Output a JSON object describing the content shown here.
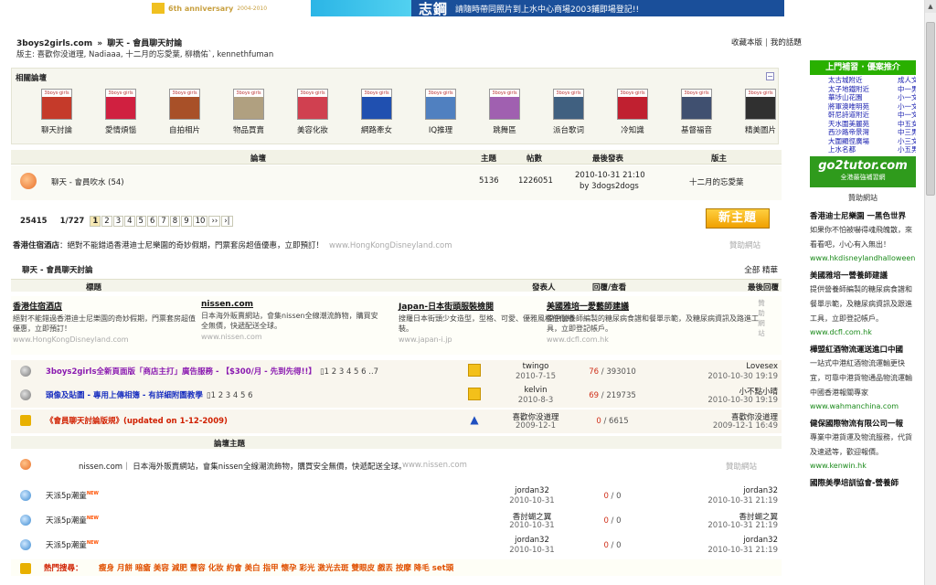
{
  "banners": {
    "left_text": "6th anniversary",
    "left_years": "2004-2010",
    "right_big": "志鋼",
    "right_text": "請隨時帶同照片到上水中心商場2003鋪即場登記!!"
  },
  "header": {
    "site": "3boys2girls.com",
    "sep": "»",
    "section": "聊天 - 會員聊天討論",
    "moderators": "版主: 喜歡你没道理, Nadiaaa, 十二月的忘愛葉, 柳橋佑`, kennethfuman",
    "user_links": [
      "收藏本版",
      "我的話題"
    ]
  },
  "related": {
    "title": "相關論壇",
    "collapse": "−",
    "tag": "3boys·girls",
    "items": [
      {
        "label": "聊天討論",
        "color": "#c53a2a"
      },
      {
        "label": "愛情煩惱",
        "color": "#d02040"
      },
      {
        "label": "自拍相片",
        "color": "#a85028"
      },
      {
        "label": "物品買賣",
        "color": "#b0a080"
      },
      {
        "label": "美容化妝",
        "color": "#d04050"
      },
      {
        "label": "網路牽女",
        "color": "#2050b0"
      },
      {
        "label": "IQ推理",
        "color": "#5080c0"
      },
      {
        "label": "跳舞區",
        "color": "#a060b0"
      },
      {
        "label": "派台歌词",
        "color": "#406080"
      },
      {
        "label": "冷知識",
        "color": "#c02030"
      },
      {
        "label": "基督福音",
        "color": "#405070"
      },
      {
        "label": "精美圖片",
        "color": "#303030"
      }
    ]
  },
  "forum_table": {
    "headers": {
      "forum": "論壇",
      "topics": "主題",
      "posts": "帖數",
      "last": "最後發表",
      "mods": "版主"
    },
    "row": {
      "name": "聊天 - 會員吹水 (54)",
      "topics": "5136",
      "posts": "1226051",
      "last_time": "2010-10-31 21:10",
      "last_by": "by 3dogs2dogs",
      "mods": "十二月的忘愛葉"
    }
  },
  "pager": {
    "total": "25415",
    "position": "1/727",
    "pages": [
      "1",
      "2",
      "3",
      "4",
      "5",
      "6",
      "7",
      "8",
      "9",
      "10",
      "››",
      "›|"
    ],
    "new_thread": "新主題"
  },
  "sponsor_line": {
    "bold": "香港住宿酒店",
    "text": "絕對不能錯過香港迪士尼樂園的奇妙假期，門票套房超值優惠，立即預訂！",
    "url": "www.HongKongDisneyland.com",
    "right": "贊助網站"
  },
  "threads_header": {
    "title": "聊天 - 會員聊天討論",
    "filter_all": "全部",
    "filter_digest": "精華",
    "col_topic": "標題",
    "col_author": "發表人",
    "col_replies": "回覆/查看",
    "col_last": "最後回覆"
  },
  "ads": [
    {
      "title": "香港住宿酒店",
      "desc": "絕對不能錯過香港迪士尼樂園的奇妙假期，門票套房超值優惠，立即預訂！",
      "url": "www.HongKongDisneyland.com"
    },
    {
      "title": "nissen.com",
      "desc": "日本海外販賣網站，會集nissen全線潮流飾物，購買安全無價，快遞配送全球。",
      "url": "www.nissen.com"
    },
    {
      "title": "Japan-日本街頭服裝檢閱",
      "desc": "搜羅日本街頭少女造型，型格、可愛、優雅風格任你組裝。",
      "url": "www.japan-i.jp"
    },
    {
      "title": "美國雅培一愛藝師建議",
      "desc": "提供營養師編製的糖尿病食譜和餐單示範，及糖尿病資訊及路進工具，立即登記帳戶。",
      "url": "www.dcfl.com.hk"
    }
  ],
  "ad_side": "贊助網站",
  "sticky_threads": [
    {
      "title": "3boys2girls全新頁面版「商店主打」廣告服務 - 【$300/月 - 先到先得!!】",
      "pages": "▯1 2 3 4 5 6 ..7",
      "author": "twingo",
      "date": "2010-7-15",
      "replies": "76",
      "views": "393010",
      "last_by": "Lovesex",
      "last_time": "2010-10-30 19:19"
    },
    {
      "title": "頭像及貼圖 - 專用上傳相簿 - 有詳細附圖教學",
      "pages": "▯1 2 3 4 5 6",
      "author": "kelvin",
      "date": "2010-8-3",
      "replies": "69",
      "views": "219735",
      "last_by": "小不點小晴",
      "last_time": "2010-10-30 19:19"
    },
    {
      "title": "《會員聊天討論版規》(updated on 1-12-2009)",
      "pages": "",
      "author": "喜歡你没道理",
      "date": "2009-12-1",
      "replies": "0",
      "views": "6615",
      "last_by": "喜歡你没道理",
      "last_time": "2009-12-1 16:49"
    }
  ],
  "normal_header": "論壇主題",
  "inline_ad": {
    "text": "nissen.com｜ 日本海外販賣網站，會集nissen全線潮流飾物，購買安全無價，快遞配送全球。",
    "url": "www.nissen.com",
    "right": "贊助網站"
  },
  "normal_threads": [
    {
      "title": "天派5p潮童",
      "new": "NEW",
      "author": "jordan32",
      "date": "2010-10-31",
      "replies": "0",
      "views": "0",
      "last_by": "jordan32",
      "last_time": "2010-10-31 21:19"
    },
    {
      "title": "天派5p潮童",
      "new": "NEW",
      "author": "香討蝴之翼",
      "date": "2010-10-31",
      "replies": "0",
      "views": "0",
      "last_by": "香討蝴之翼",
      "last_time": "2010-10-31 21:19"
    },
    {
      "title": "天派5p潮童",
      "new": "NEW",
      "author": "jordan32",
      "date": "2010-10-31",
      "replies": "0",
      "views": "0",
      "last_by": "jordan32",
      "last_time": "2010-10-31 21:19"
    }
  ],
  "hot_search": {
    "label": "熱門搜尋：",
    "terms": "瘦身 月餅 暗瘡 美容 減肥 豐容 化妝 約會 美白 指甲 懷孕 彩光 激光去斑 雙眼皮 戲丟 按摩 降毛 set頭"
  },
  "sidebar": {
    "head": "上門補習 · 優案推介",
    "links": [
      [
        "太古城附近",
        "成人文"
      ],
      [
        "太子地鐵附近",
        "中一男"
      ],
      [
        "華埗山花園",
        "小一文"
      ],
      [
        "將軍澳唯明苑",
        "小一文"
      ],
      [
        "軒尼詩道附近",
        "中一文"
      ],
      [
        "天水圍美麗苑",
        "中五女"
      ],
      [
        "西沙路帝景灣",
        "中三男"
      ],
      [
        "大圍顯徑廣場",
        "小三文"
      ],
      [
        "上水名都",
        "小五男"
      ]
    ],
    "logo_big": "go2tutor.com",
    "logo_small": "全港最強補習網",
    "sponsor_label": "贊助網站",
    "ads": [
      {
        "title": "香港迪士尼樂園 一黑色世界",
        "desc": "如果你不怕被嚇得魂飛魄散，來看看吧，小心有入無出！",
        "url": "www.hkdisneylandhalloween"
      },
      {
        "title": "美國雅培一營養師建議",
        "desc": "提供營養師編製的糖尿病食譜和餐單示範，及糖尿病資訊及跟進工具，立即登記帳戶。",
        "url": "www.dcfl.com.hk"
      },
      {
        "title": "樺盟紅酒物流運送進口中國",
        "desc": "一站式中港紅酒物流運輸更快宜，可靠中港貨物通品物流運輸中國香港報關專家",
        "url": "www.wahmanchina.com"
      },
      {
        "title": "健保國際物流有限公司一報",
        "desc": "專業中港貨運及物流服務，代貨及速遞等，歡迎報價。",
        "url": "www.kenwin.hk"
      },
      {
        "title": "國際美學培訓協會-營養師",
        "desc": "",
        "url": ""
      }
    ]
  },
  "colors": {
    "accent_green": "#29b000",
    "sticky_bg": "#f9f6ee",
    "reply_red": "#d0301a"
  }
}
